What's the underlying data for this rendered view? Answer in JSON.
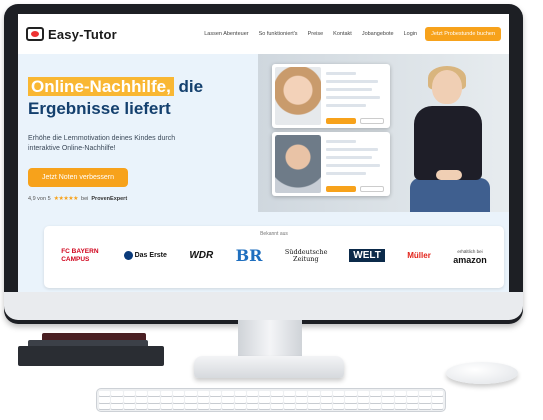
{
  "site": {
    "brand": "Easy-Tutor",
    "menu": [
      "Lassen Abenteuer",
      "So funktioniert's",
      "Preise",
      "Kontakt",
      "Jobangebote",
      "Login"
    ],
    "cta_small": "Jetzt Probestunde buchen"
  },
  "hero": {
    "headline_highlight": "Online-Nachhilfe,",
    "headline_rest": " die",
    "headline_line2": "Ergebnisse liefert",
    "subtitle": "Erhöhe die Lernmotivation deines Kindes durch interaktive Online-Nachhilfe!",
    "cta": "Jetzt Noten verbessern",
    "rating_text": "4,9 von 5",
    "stars": "★★★★★",
    "rating_label": "bei",
    "rating_source": "ProvenExpert"
  },
  "trust": {
    "title": "Bekannt aus",
    "logos": [
      "FC BAYERN CAMPUS",
      "Das Erste",
      "WDR",
      "BR",
      "Süddeutsche Zeitung",
      "WELT",
      "Müller",
      "amazon"
    ],
    "amazon_sub": "erhältlich bei"
  },
  "colors": {
    "accent": "#f7a21b",
    "primary_text": "#14406e",
    "hero_bg": "#eaf3fb",
    "monitor": "#1d1f24"
  }
}
